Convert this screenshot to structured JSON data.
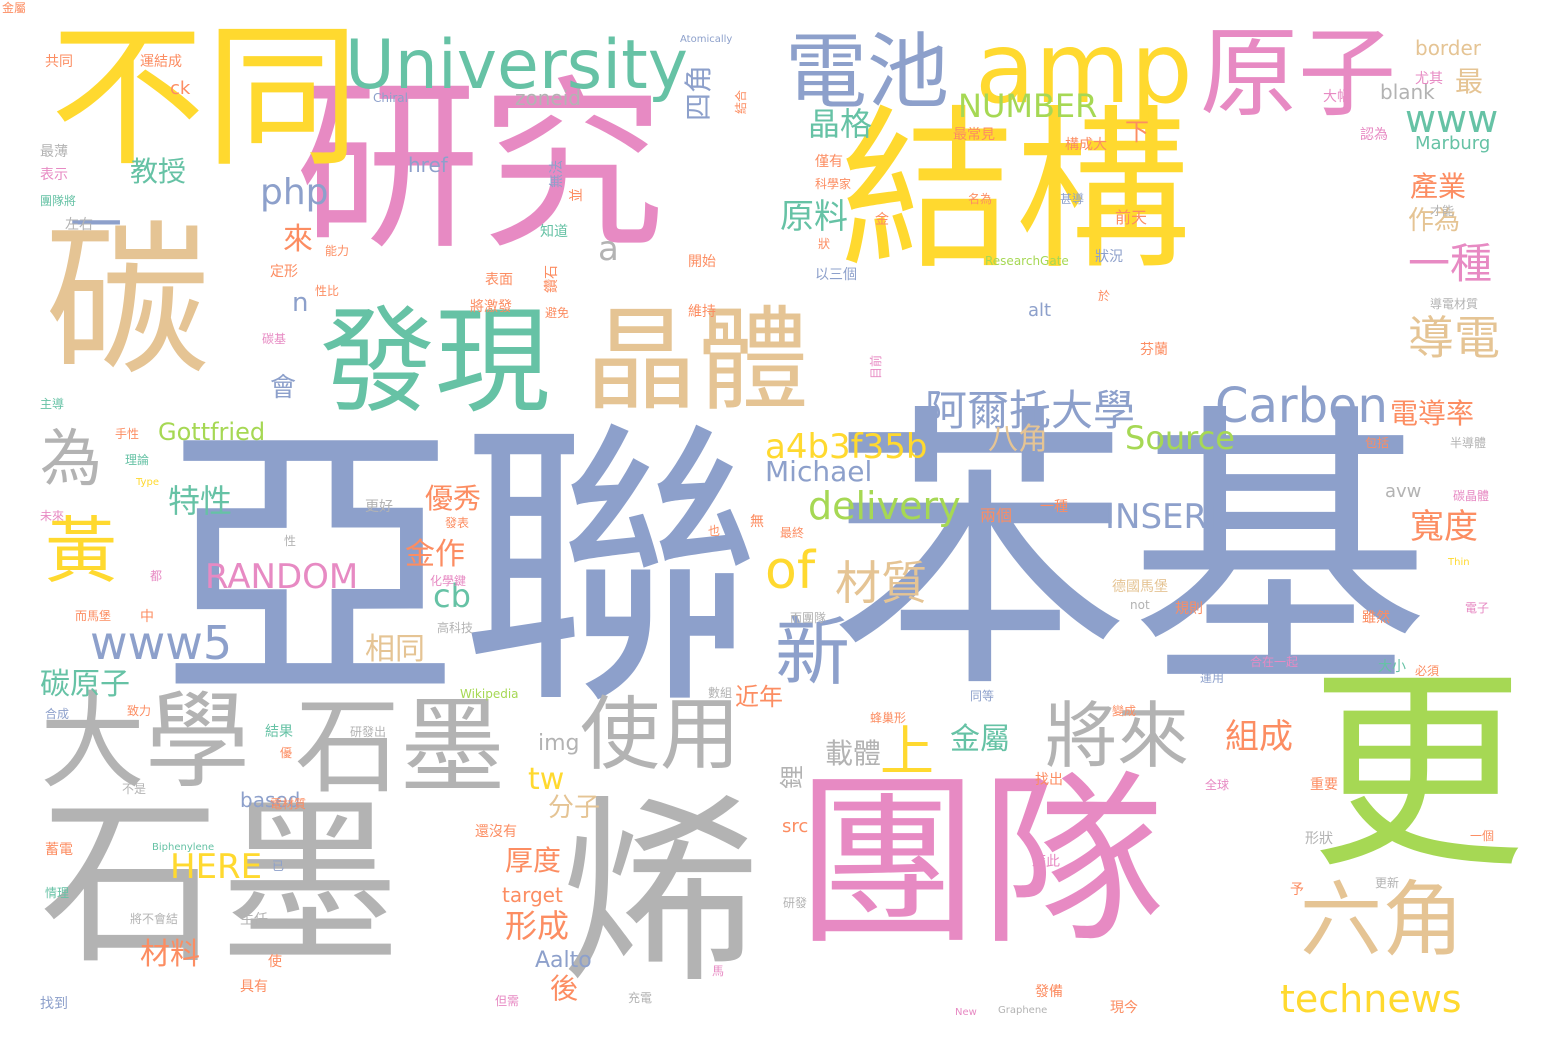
{
  "palette": {
    "yellow": "#ffd92f",
    "pink": "#e78ac3",
    "tan": "#e5c494",
    "green": "#66c2a5",
    "blue": "#8da0cb",
    "grey": "#b3b3b3",
    "lime": "#a6d854",
    "orange": "#fc8d62"
  },
  "words": [
    {
      "text": "亞聯",
      "color": "blue"
    },
    {
      "text": "苯基",
      "color": "blue"
    },
    {
      "text": "研究",
      "color": "pink"
    },
    {
      "text": "結構",
      "color": "yellow"
    },
    {
      "text": "團隊",
      "color": "pink"
    },
    {
      "text": "石墨",
      "color": "grey"
    },
    {
      "text": "烯",
      "color": "grey"
    },
    {
      "text": "碳",
      "color": "tan"
    },
    {
      "text": "更",
      "color": "lime"
    },
    {
      "text": "不同",
      "color": "yellow"
    },
    {
      "text": "發現",
      "color": "green"
    },
    {
      "text": "晶體",
      "color": "tan"
    },
    {
      "text": "amp",
      "color": "yellow"
    },
    {
      "text": "原子",
      "color": "pink"
    },
    {
      "text": "University",
      "color": "green"
    },
    {
      "text": "電池",
      "color": "blue"
    },
    {
      "text": "大學",
      "color": "grey"
    },
    {
      "text": "石墨",
      "color": "grey"
    },
    {
      "text": "使用",
      "color": "grey"
    },
    {
      "text": "將來",
      "color": "grey"
    },
    {
      "text": "新",
      "color": "blue"
    },
    {
      "text": "六角",
      "color": "tan"
    },
    {
      "text": "黃",
      "color": "yellow"
    },
    {
      "text": "為",
      "color": "grey"
    },
    {
      "text": "一",
      "color": "blue"
    },
    {
      "text": "阿爾托大學",
      "color": "blue"
    },
    {
      "text": "Carbon",
      "color": "blue"
    },
    {
      "text": "of",
      "color": "yellow"
    },
    {
      "text": "上",
      "color": "yellow"
    },
    {
      "text": "technews",
      "color": "yellow"
    },
    {
      "text": "delivery",
      "color": "lime"
    },
    {
      "text": "a4b3f35b",
      "color": "yellow"
    },
    {
      "text": "www5",
      "color": "blue"
    },
    {
      "text": "材質",
      "color": "tan"
    },
    {
      "text": "RANDOM",
      "color": "pink"
    },
    {
      "text": "INSERT",
      "color": "blue"
    },
    {
      "text": "Source",
      "color": "lime"
    },
    {
      "text": "NUMBER",
      "color": "lime"
    },
    {
      "text": "導電",
      "color": "tan"
    },
    {
      "text": "一種",
      "color": "pink"
    },
    {
      "text": "www",
      "color": "green"
    },
    {
      "text": "php",
      "color": "blue"
    },
    {
      "text": "晶格",
      "color": "green"
    },
    {
      "text": "四角",
      "color": "blue"
    },
    {
      "text": "原料",
      "color": "green"
    },
    {
      "text": "a",
      "color": "grey"
    },
    {
      "text": "電導率",
      "color": "orange"
    },
    {
      "text": "Michael",
      "color": "blue"
    },
    {
      "text": "Gottfried",
      "color": "lime"
    },
    {
      "text": "特性",
      "color": "green"
    },
    {
      "text": "碳原子",
      "color": "green"
    },
    {
      "text": "HERE",
      "color": "yellow"
    },
    {
      "text": "cb",
      "color": "green"
    },
    {
      "text": "組成",
      "color": "orange"
    },
    {
      "text": "金屬",
      "color": "green"
    },
    {
      "text": "寬度",
      "color": "orange"
    },
    {
      "text": "八角",
      "color": "tan"
    },
    {
      "text": "產業",
      "color": "orange"
    },
    {
      "text": "作為",
      "color": "tan"
    },
    {
      "text": "教授",
      "color": "green"
    },
    {
      "text": "優秀",
      "color": "orange"
    },
    {
      "text": "相同",
      "color": "tan"
    },
    {
      "text": "金作",
      "color": "orange"
    },
    {
      "text": "厚度",
      "color": "orange"
    },
    {
      "text": "形成",
      "color": "orange"
    },
    {
      "text": "材料",
      "color": "orange"
    },
    {
      "text": "分子",
      "color": "tan"
    },
    {
      "text": "載體",
      "color": "grey"
    },
    {
      "text": "tw",
      "color": "yellow"
    },
    {
      "text": "n",
      "color": "blue"
    },
    {
      "text": "來",
      "color": "orange"
    },
    {
      "text": "會",
      "color": "blue"
    },
    {
      "text": "最",
      "color": "tan"
    },
    {
      "text": "後",
      "color": "orange"
    },
    {
      "text": "下",
      "color": "orange"
    },
    {
      "text": "鋰",
      "color": "grey"
    },
    {
      "text": "近年",
      "color": "orange"
    },
    {
      "text": "img",
      "color": "grey"
    },
    {
      "text": "src",
      "color": "orange"
    },
    {
      "text": "target",
      "color": "orange"
    },
    {
      "text": "Aalto",
      "color": "blue"
    },
    {
      "text": "based",
      "color": "blue"
    },
    {
      "text": "zoneid",
      "color": "grey"
    },
    {
      "text": "href",
      "color": "blue"
    },
    {
      "text": "blank",
      "color": "grey"
    },
    {
      "text": "border",
      "color": "tan"
    },
    {
      "text": "Marburg",
      "color": "green"
    },
    {
      "text": "alt",
      "color": "blue"
    },
    {
      "text": "avw",
      "color": "grey"
    },
    {
      "text": "ck",
      "color": "orange"
    },
    {
      "text": "共同",
      "color": "orange"
    },
    {
      "text": "運結成",
      "color": "orange"
    },
    {
      "text": "Atomically",
      "color": "blue"
    },
    {
      "text": "尤其",
      "color": "pink"
    },
    {
      "text": "Chiral",
      "color": "blue"
    },
    {
      "text": "結合",
      "color": "orange"
    },
    {
      "text": "大幅",
      "color": "pink"
    },
    {
      "text": "最常見",
      "color": "orange"
    },
    {
      "text": "構成大",
      "color": "orange"
    },
    {
      "text": "認為",
      "color": "pink"
    },
    {
      "text": "僅有",
      "color": "orange"
    },
    {
      "text": "科學家",
      "color": "orange"
    },
    {
      "text": "才能",
      "color": "grey"
    },
    {
      "text": "名為",
      "color": "orange"
    },
    {
      "text": "甚導",
      "color": "blue"
    },
    {
      "text": "前天",
      "color": "orange"
    },
    {
      "text": "無法",
      "color": "blue"
    },
    {
      "text": "並",
      "color": "orange"
    },
    {
      "text": "知道",
      "color": "green"
    },
    {
      "text": "開始",
      "color": "orange"
    },
    {
      "text": "維持",
      "color": "orange"
    },
    {
      "text": "鑽石",
      "color": "orange"
    },
    {
      "text": "避免",
      "color": "orange"
    },
    {
      "text": "以三個",
      "color": "blue"
    },
    {
      "text": "ResearchGate",
      "color": "lime"
    },
    {
      "text": "狀況",
      "color": "blue"
    },
    {
      "text": "於",
      "color": "orange"
    },
    {
      "text": "導電材質",
      "color": "grey"
    },
    {
      "text": "芬蘭",
      "color": "orange"
    },
    {
      "text": "表面",
      "color": "orange"
    },
    {
      "text": "將激發",
      "color": "orange"
    },
    {
      "text": "目前",
      "color": "pink"
    },
    {
      "text": "最薄",
      "color": "grey"
    },
    {
      "text": "表示",
      "color": "pink"
    },
    {
      "text": "團隊將",
      "color": "green"
    },
    {
      "text": "左右",
      "color": "grey"
    },
    {
      "text": "能力",
      "color": "orange"
    },
    {
      "text": "定形",
      "color": "orange"
    },
    {
      "text": "性比",
      "color": "orange"
    },
    {
      "text": "碳基",
      "color": "pink"
    },
    {
      "text": "主導",
      "color": "green"
    },
    {
      "text": "手性",
      "color": "orange"
    },
    {
      "text": "理論",
      "color": "green"
    },
    {
      "text": "Type",
      "color": "yellow"
    },
    {
      "text": "未來",
      "color": "pink"
    },
    {
      "text": "發表",
      "color": "orange"
    },
    {
      "text": "更好",
      "color": "grey"
    },
    {
      "text": "性",
      "color": "grey"
    },
    {
      "text": "都",
      "color": "pink"
    },
    {
      "text": "而馬堡",
      "color": "orange"
    },
    {
      "text": "中",
      "color": "orange"
    },
    {
      "text": "化學鍵",
      "color": "pink"
    },
    {
      "text": "高科技",
      "color": "grey"
    },
    {
      "text": "而團隊",
      "color": "grey"
    },
    {
      "text": "Wikipedia",
      "color": "lime"
    },
    {
      "text": "合成",
      "color": "blue"
    },
    {
      "text": "致力",
      "color": "orange"
    },
    {
      "text": "結果",
      "color": "green"
    },
    {
      "text": "研發出",
      "color": "grey"
    },
    {
      "text": "優",
      "color": "orange"
    },
    {
      "text": "不是",
      "color": "grey"
    },
    {
      "text": "還沒有",
      "color": "orange"
    },
    {
      "text": "Biphenylene",
      "color": "green"
    },
    {
      "text": "蓄電",
      "color": "orange"
    },
    {
      "text": "情理",
      "color": "green"
    },
    {
      "text": "將不會結",
      "color": "grey"
    },
    {
      "text": "主任",
      "color": "grey"
    },
    {
      "text": "具有",
      "color": "orange"
    },
    {
      "text": "找到",
      "color": "blue"
    },
    {
      "text": "但需",
      "color": "pink"
    },
    {
      "text": "充電",
      "color": "grey"
    },
    {
      "text": "New",
      "color": "pink"
    },
    {
      "text": "Graphene",
      "color": "grey"
    },
    {
      "text": "發備",
      "color": "orange"
    },
    {
      "text": "現今",
      "color": "orange"
    },
    {
      "text": "電子",
      "color": "pink"
    },
    {
      "text": "Thin",
      "color": "yellow"
    },
    {
      "text": "半導體",
      "color": "grey"
    },
    {
      "text": "包括",
      "color": "orange"
    },
    {
      "text": "碳晶體",
      "color": "pink"
    },
    {
      "text": "德國馬堡",
      "color": "tan"
    },
    {
      "text": "規則",
      "color": "orange"
    },
    {
      "text": "雖然",
      "color": "orange"
    },
    {
      "text": "not",
      "color": "grey"
    },
    {
      "text": "大小",
      "color": "green"
    },
    {
      "text": "必須",
      "color": "orange"
    },
    {
      "text": "合在一起",
      "color": "pink"
    },
    {
      "text": "運用",
      "color": "blue"
    },
    {
      "text": "變成",
      "color": "orange"
    },
    {
      "text": "同等",
      "color": "blue"
    },
    {
      "text": "蜂巢形",
      "color": "orange"
    },
    {
      "text": "重要",
      "color": "orange"
    },
    {
      "text": "形狀",
      "color": "grey"
    },
    {
      "text": "一個",
      "color": "orange"
    },
    {
      "text": "更新",
      "color": "grey"
    },
    {
      "text": "予",
      "color": "orange"
    },
    {
      "text": "藉此",
      "color": "pink"
    },
    {
      "text": "找出",
      "color": "orange"
    },
    {
      "text": "全球",
      "color": "pink"
    },
    {
      "text": "無",
      "color": "orange"
    },
    {
      "text": "最終",
      "color": "orange"
    },
    {
      "text": "研發",
      "color": "grey"
    },
    {
      "text": "也",
      "color": "orange"
    },
    {
      "text": "一種",
      "color": "orange"
    },
    {
      "text": "數組",
      "color": "grey"
    },
    {
      "text": "電材質",
      "color": "orange"
    },
    {
      "text": "馬",
      "color": "pink"
    },
    {
      "text": "已",
      "color": "blue"
    },
    {
      "text": "使",
      "color": "orange"
    },
    {
      "text": "金",
      "color": "orange"
    },
    {
      "text": "狀",
      "color": "orange"
    },
    {
      "text": "兩個",
      "color": "orange"
    },
    {
      "text": "金屬",
      "color": "orange"
    }
  ]
}
